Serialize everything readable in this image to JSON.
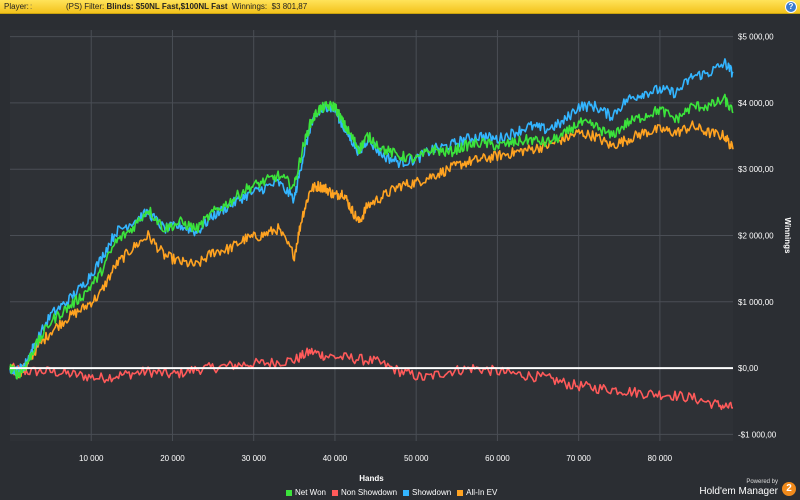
{
  "header": {
    "player_label": "Player:",
    "player_value": ":",
    "filter_prefix": "(PS) Filter:",
    "filter_value": "Blinds: $50NL Fast,$100NL Fast",
    "winnings_label": "Winnings:",
    "winnings_value": "$3 801,87",
    "help_glyph": "?"
  },
  "branding": {
    "powered_by": "Powered by",
    "product": "Hold'em Manager",
    "logo_glyph": "2"
  },
  "chart_data": {
    "type": "line",
    "xlabel": "Hands",
    "ylabel": "Winnings",
    "xlim": [
      0,
      89000
    ],
    "ylim": [
      -1100,
      5100
    ],
    "x_ticks": [
      10000,
      20000,
      30000,
      40000,
      50000,
      60000,
      70000,
      80000
    ],
    "x_tick_labels": [
      "10 000",
      "20 000",
      "30 000",
      "40 000",
      "50 000",
      "60 000",
      "70 000",
      "80 000"
    ],
    "y_ticks": [
      -1000,
      0,
      1000,
      2000,
      3000,
      4000,
      5000
    ],
    "y_tick_labels": [
      "-$1 000,00",
      "$0,00",
      "$1 000,00",
      "$2 000,00",
      "$3 000,00",
      "$4 000,00",
      "$5 000,00"
    ],
    "grid": true,
    "legend_position": "bottom",
    "zero_line_color": "#ffffff",
    "series": [
      {
        "name": "Net Won",
        "color": "#3be33b",
        "x": [
          0,
          1000,
          2000,
          3000,
          5000,
          7000,
          9000,
          11000,
          13000,
          15000,
          17000,
          19000,
          21000,
          23000,
          25000,
          27000,
          29000,
          31000,
          33000,
          35000,
          36000,
          37000,
          38000,
          39000,
          40000,
          41000,
          42000,
          43000,
          44000,
          46000,
          48000,
          50000,
          52000,
          54000,
          56000,
          58000,
          60000,
          62000,
          64000,
          66000,
          68000,
          70000,
          72000,
          74000,
          76000,
          78000,
          80000,
          82000,
          84000,
          86000,
          88000,
          89000
        ],
        "y": [
          0,
          -100,
          50,
          300,
          700,
          900,
          1100,
          1400,
          1900,
          2100,
          2400,
          2100,
          2200,
          2100,
          2350,
          2500,
          2700,
          2800,
          2900,
          2750,
          3300,
          3700,
          3900,
          3950,
          3950,
          3700,
          3500,
          3300,
          3500,
          3300,
          3200,
          3150,
          3300,
          3250,
          3350,
          3400,
          3350,
          3400,
          3450,
          3400,
          3500,
          3700,
          3650,
          3500,
          3700,
          3800,
          3900,
          3750,
          3950,
          3950,
          4050,
          3850
        ]
      },
      {
        "name": "Non Showdown",
        "color": "#ff5a5a",
        "x": [
          0,
          2000,
          5000,
          8000,
          11000,
          14000,
          17000,
          20000,
          23000,
          26000,
          29000,
          32000,
          35000,
          37000,
          39000,
          42000,
          45000,
          48000,
          51000,
          54000,
          57000,
          60000,
          63000,
          66000,
          69000,
          72000,
          75000,
          78000,
          81000,
          84000,
          87000,
          89000
        ],
        "y": [
          0,
          -50,
          -50,
          -100,
          -150,
          -100,
          -50,
          -100,
          -20,
          20,
          60,
          80,
          120,
          250,
          180,
          150,
          100,
          -50,
          -150,
          -50,
          0,
          -50,
          -100,
          -150,
          -250,
          -300,
          -330,
          -380,
          -400,
          -450,
          -550,
          -600
        ]
      },
      {
        "name": "Showdown",
        "color": "#33b5ff",
        "x": [
          0,
          1000,
          2000,
          3000,
          5000,
          7000,
          9000,
          11000,
          13000,
          15000,
          17000,
          19000,
          21000,
          23000,
          25000,
          27000,
          29000,
          31000,
          33000,
          35000,
          36000,
          37000,
          38000,
          39000,
          40000,
          41000,
          42000,
          43000,
          44000,
          46000,
          48000,
          50000,
          52000,
          54000,
          56000,
          58000,
          60000,
          62000,
          64000,
          66000,
          68000,
          70000,
          72000,
          74000,
          76000,
          78000,
          80000,
          82000,
          84000,
          86000,
          88000,
          89000
        ],
        "y": [
          0,
          -50,
          80,
          350,
          800,
          1000,
          1250,
          1600,
          2050,
          2200,
          2350,
          2100,
          2150,
          2050,
          2300,
          2450,
          2600,
          2700,
          2800,
          2550,
          3150,
          3650,
          3850,
          3950,
          3900,
          3650,
          3450,
          3250,
          3450,
          3200,
          3100,
          3150,
          3300,
          3350,
          3450,
          3500,
          3450,
          3550,
          3650,
          3600,
          3700,
          3950,
          3950,
          3800,
          4050,
          4150,
          4200,
          4150,
          4400,
          4450,
          4600,
          4450
        ]
      },
      {
        "name": "All-In EV",
        "color": "#ffa321",
        "x": [
          0,
          1000,
          2000,
          3000,
          5000,
          7000,
          9000,
          11000,
          13000,
          15000,
          17000,
          19000,
          21000,
          23000,
          25000,
          27000,
          29000,
          31000,
          33000,
          35000,
          36000,
          37000,
          38000,
          39000,
          40000,
          41000,
          42000,
          43000,
          44000,
          46000,
          48000,
          50000,
          52000,
          54000,
          56000,
          58000,
          60000,
          62000,
          64000,
          66000,
          68000,
          70000,
          72000,
          74000,
          76000,
          78000,
          80000,
          82000,
          84000,
          86000,
          88000,
          89000
        ],
        "y": [
          0,
          -80,
          20,
          250,
          550,
          750,
          900,
          1100,
          1550,
          1800,
          2000,
          1700,
          1600,
          1550,
          1750,
          1800,
          1950,
          2000,
          2100,
          1700,
          2300,
          2700,
          2750,
          2700,
          2600,
          2650,
          2400,
          2200,
          2450,
          2600,
          2750,
          2800,
          2900,
          3000,
          3100,
          3150,
          3200,
          3250,
          3300,
          3350,
          3450,
          3550,
          3500,
          3350,
          3450,
          3550,
          3600,
          3550,
          3650,
          3550,
          3500,
          3300
        ]
      }
    ]
  }
}
